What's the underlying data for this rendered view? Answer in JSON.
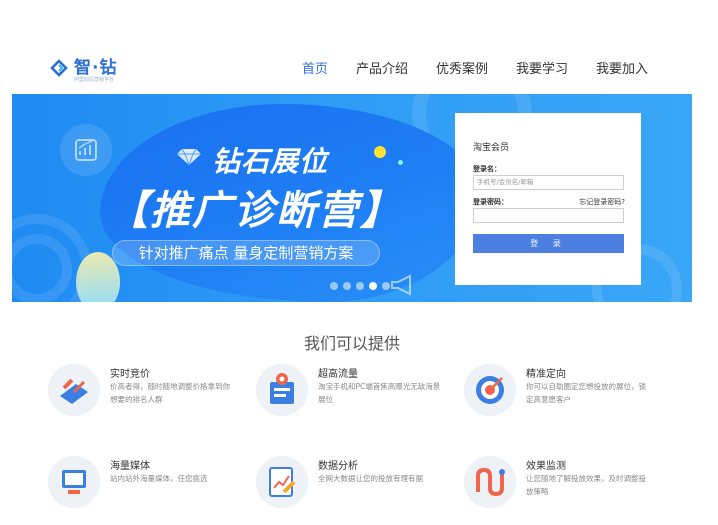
{
  "header": {
    "logo_text": "智·钻",
    "logo_sub": "阿里妈妈营销平台",
    "nav": [
      "首页",
      "产品介绍",
      "优秀案例",
      "我要学习",
      "我要加入"
    ],
    "active_index": 0
  },
  "banner": {
    "title_line1": "钻石展位",
    "title_line2": "【推广诊断营】",
    "subtitle": "针对推广痛点  量身定制营销方案",
    "slides": 5,
    "active_slide": 3
  },
  "login": {
    "title": "淘宝会员",
    "username_label": "登录名：",
    "username_placeholder": "手机号/会员名/邮箱",
    "password_label": "登录密码：",
    "forgot": "忘记登录密码?",
    "submit": "登  录"
  },
  "section": {
    "title": "我们可以提供",
    "features": [
      {
        "title": "实时竞价",
        "desc": "价高者得，随时随地调整价格拿到你想要的排名人群",
        "icon": "bid-icon"
      },
      {
        "title": "超高流量",
        "desc": "淘宝手机和PC端首焦高曝光无敌海景展位",
        "icon": "traffic-icon"
      },
      {
        "title": "精准定向",
        "desc": "你可以自助圈定您想投放的展位，锁定高意愿客户",
        "icon": "target-icon"
      },
      {
        "title": "海量媒体",
        "desc": "站内站外海量媒体，任您挑选",
        "icon": "media-icon"
      },
      {
        "title": "数据分析",
        "desc": "全网大数据让您的投放有理有据",
        "icon": "analytics-icon"
      },
      {
        "title": "效果监测",
        "desc": "让您随地了解投放效果，及时调整投放策略",
        "icon": "monitor-icon"
      }
    ]
  },
  "colors": {
    "brand": "#2e6fd6",
    "banner": "#1f8af2",
    "button": "#4d7fe0"
  }
}
